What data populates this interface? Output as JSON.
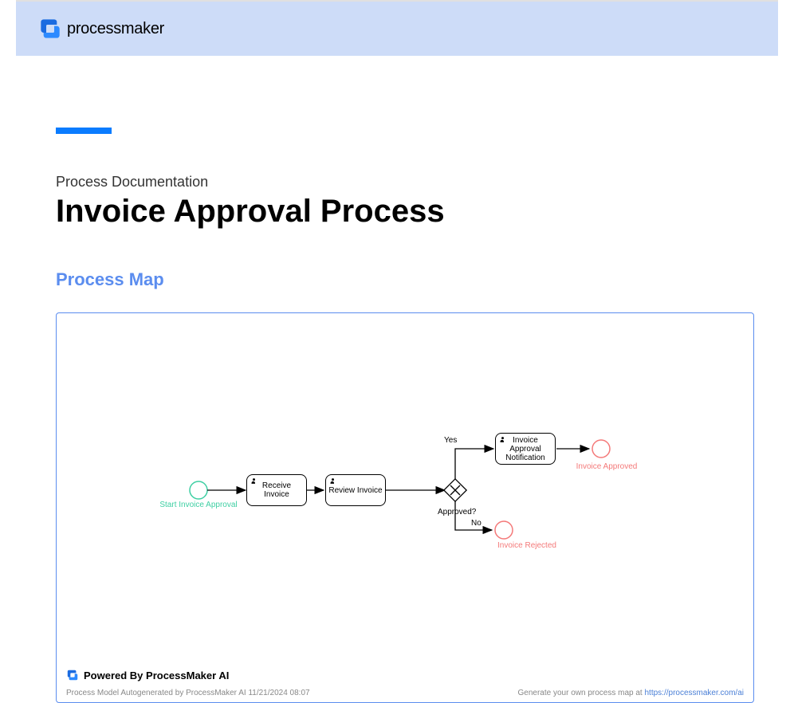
{
  "brand": {
    "name": "processmaker",
    "powered_by": "Powered By ProcessMaker AI"
  },
  "document": {
    "subtitle": "Process Documentation",
    "title": "Invoice Approval Process",
    "section_label": "Process Map"
  },
  "diagram": {
    "start_event": "Start Invoice Approval",
    "task1": "Receive Invoice",
    "task2": "Review Invoice",
    "task3": "Invoice Approval Notification",
    "gateway": "Approved?",
    "yes_label": "Yes",
    "no_label": "No",
    "end_approved": "Invoice Approved",
    "end_rejected": "Invoice Rejected"
  },
  "footer": {
    "meta": "Process Model Autogenerated by ProcessMaker AI 11/21/2024 08:07",
    "cta_text": "Generate your own process map at ",
    "cta_link": "https://processmaker.com/ai"
  }
}
